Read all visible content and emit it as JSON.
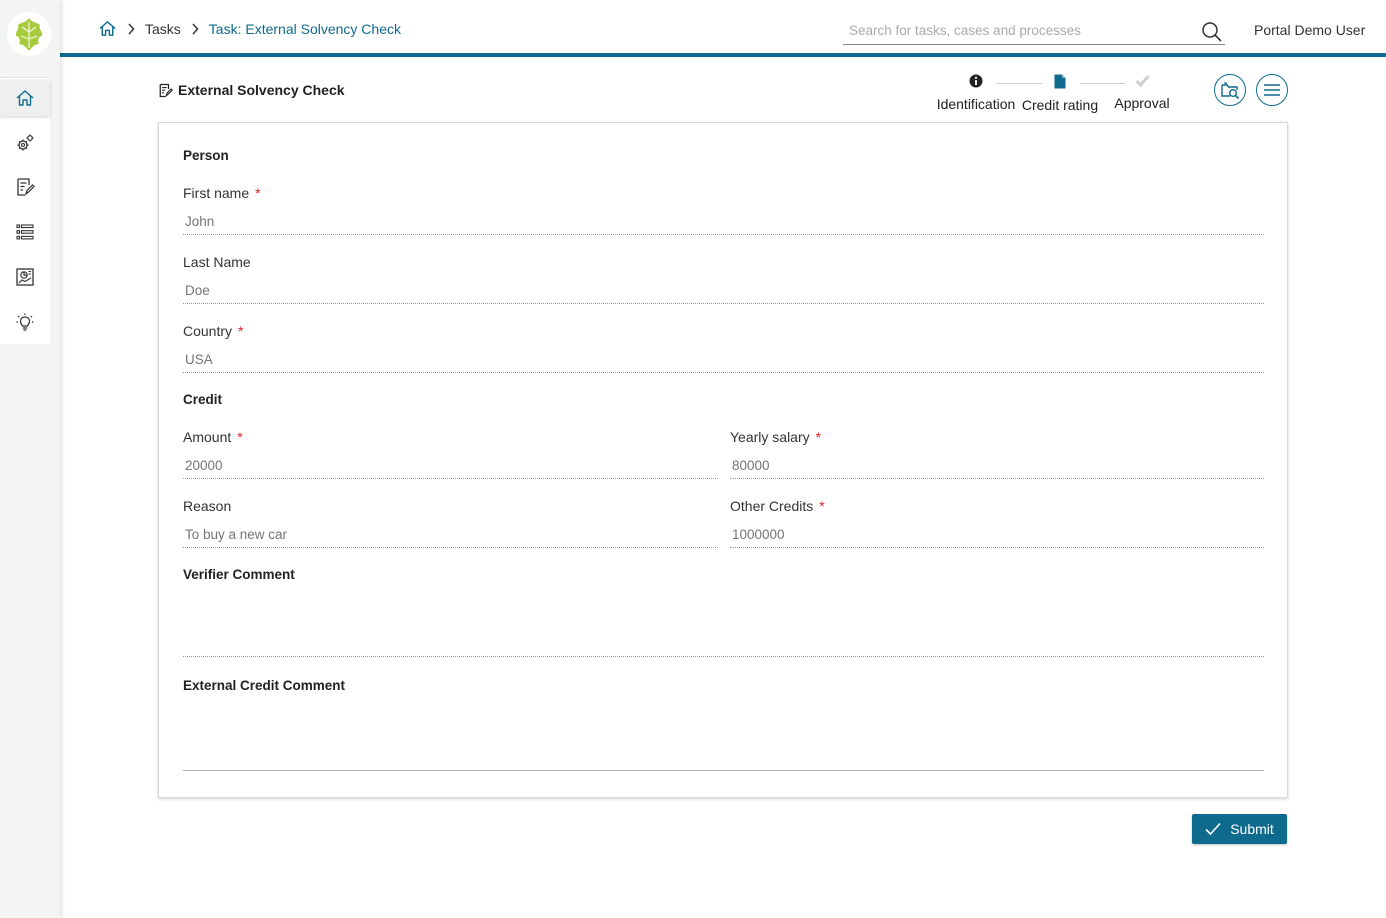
{
  "breadcrumb": {
    "home_icon": "home-icon",
    "items": [
      "Tasks",
      "Task: External Solvency Check"
    ]
  },
  "search": {
    "placeholder": "Search for tasks, cases and processes"
  },
  "user": {
    "name": "Portal Demo User"
  },
  "sidebar": {
    "items": [
      {
        "icon": "home-icon",
        "active": true
      },
      {
        "icon": "gears-icon"
      },
      {
        "icon": "task-edit-icon"
      },
      {
        "icon": "case-list-icon"
      },
      {
        "icon": "statistics-icon"
      },
      {
        "icon": "lightbulb-icon"
      }
    ]
  },
  "task": {
    "title": "External Solvency Check"
  },
  "stepper": {
    "steps": [
      {
        "label": "Identification",
        "icon": "info-icon",
        "state": "done"
      },
      {
        "label": "Credit rating",
        "icon": "document-icon",
        "state": "current"
      },
      {
        "label": "Approval",
        "icon": "check-icon",
        "state": "pending"
      }
    ]
  },
  "form": {
    "person_section": "Person",
    "first_name": {
      "label": "First name",
      "required": "*",
      "placeholder": "John"
    },
    "last_name": {
      "label": "Last Name",
      "placeholder": "Doe"
    },
    "country": {
      "label": "Country",
      "required": "*",
      "placeholder": "USA"
    },
    "credit_section": "Credit",
    "amount": {
      "label": "Amount",
      "required": "*",
      "placeholder": "20000"
    },
    "yearly_salary": {
      "label": "Yearly salary",
      "required": "*",
      "placeholder": "80000"
    },
    "reason": {
      "label": "Reason",
      "placeholder": "To buy a new car"
    },
    "other_credits": {
      "label": "Other Credits",
      "required": "*",
      "placeholder": "1000000"
    },
    "verifier_comment": "Verifier Comment",
    "external_credit_comment": "External Credit Comment"
  },
  "actions": {
    "submit_label": "Submit"
  },
  "colors": {
    "accent": "#0e6b8e",
    "required": "#dd2222",
    "logo_leaf": "#9cc63a"
  }
}
